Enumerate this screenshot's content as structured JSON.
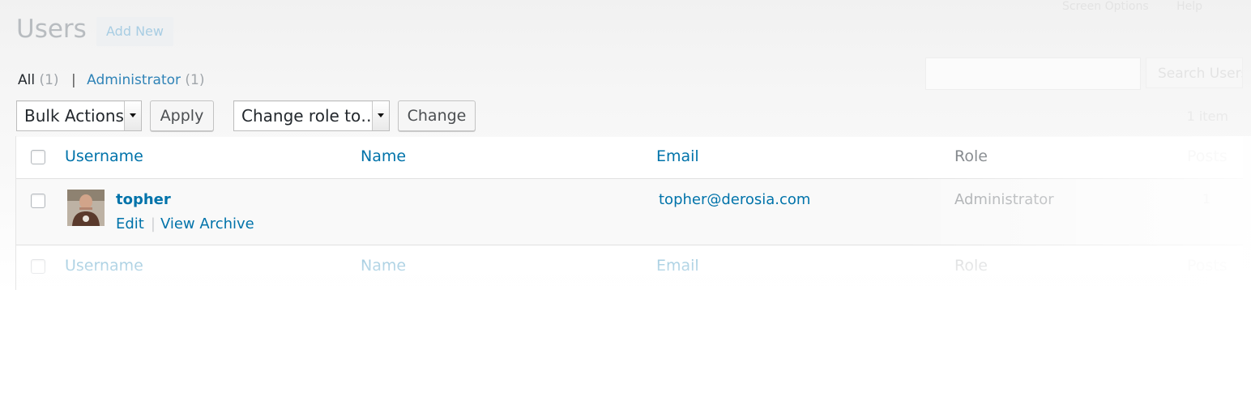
{
  "header": {
    "screen_options_label": "Screen Options",
    "help_label": "Help",
    "title": "Users",
    "add_new_label": "Add New"
  },
  "filters": {
    "all": {
      "label": "All",
      "count": "(1)"
    },
    "separator": "|",
    "administrator": {
      "label": "Administrator",
      "count": "(1)"
    }
  },
  "search": {
    "value": "",
    "button_label": "Search Users"
  },
  "bulk_actions": {
    "selected": "Bulk Actions",
    "apply_label": "Apply"
  },
  "change_role": {
    "selected": "Change role to…",
    "change_label": "Change"
  },
  "pagination": {
    "items": "1 item"
  },
  "table": {
    "columns": {
      "username": "Username",
      "name": "Name",
      "email": "Email",
      "role": "Role",
      "posts": "Posts"
    },
    "rows": [
      {
        "username": "topher",
        "name": "",
        "email": "topher@derosia.com",
        "role": "Administrator",
        "posts": "1",
        "actions": [
          "Edit",
          "View Archive"
        ],
        "action_separator": "|"
      }
    ]
  },
  "colors": {
    "link": "#0073aa",
    "muted_text": "#72777c",
    "table_border": "#e1e1e1"
  }
}
